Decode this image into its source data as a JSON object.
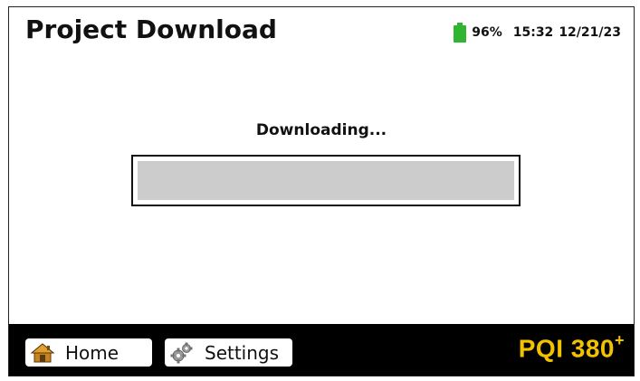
{
  "header": {
    "title": "Project Download",
    "battery": {
      "icon": "battery-icon",
      "level_percent": 96,
      "label": "96%",
      "color": "#2fb52f"
    },
    "time": "15:32",
    "date": "12/21/23"
  },
  "progress": {
    "label": "Downloading...",
    "value_percent": 0
  },
  "footer": {
    "home": {
      "label": "Home",
      "icon": "home-icon"
    },
    "settings": {
      "label": "Settings",
      "icon": "gear-icon"
    },
    "brand": {
      "text": "PQI 380",
      "superscript": "+",
      "color": "#f2c200"
    }
  }
}
